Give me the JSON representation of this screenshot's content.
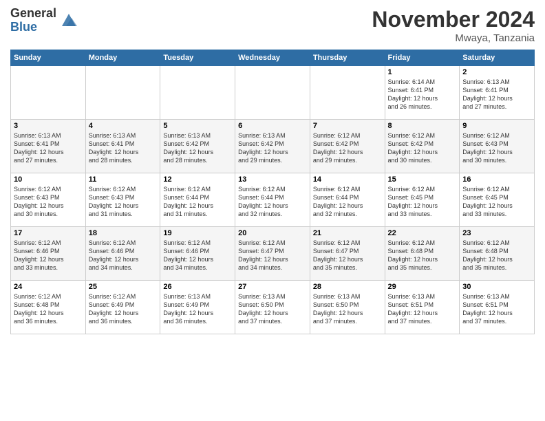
{
  "logo": {
    "general": "General",
    "blue": "Blue"
  },
  "header": {
    "month": "November 2024",
    "location": "Mwaya, Tanzania"
  },
  "weekdays": [
    "Sunday",
    "Monday",
    "Tuesday",
    "Wednesday",
    "Thursday",
    "Friday",
    "Saturday"
  ],
  "weeks": [
    [
      {
        "day": "",
        "info": ""
      },
      {
        "day": "",
        "info": ""
      },
      {
        "day": "",
        "info": ""
      },
      {
        "day": "",
        "info": ""
      },
      {
        "day": "",
        "info": ""
      },
      {
        "day": "1",
        "info": "Sunrise: 6:14 AM\nSunset: 6:41 PM\nDaylight: 12 hours\nand 26 minutes."
      },
      {
        "day": "2",
        "info": "Sunrise: 6:13 AM\nSunset: 6:41 PM\nDaylight: 12 hours\nand 27 minutes."
      }
    ],
    [
      {
        "day": "3",
        "info": "Sunrise: 6:13 AM\nSunset: 6:41 PM\nDaylight: 12 hours\nand 27 minutes."
      },
      {
        "day": "4",
        "info": "Sunrise: 6:13 AM\nSunset: 6:41 PM\nDaylight: 12 hours\nand 28 minutes."
      },
      {
        "day": "5",
        "info": "Sunrise: 6:13 AM\nSunset: 6:42 PM\nDaylight: 12 hours\nand 28 minutes."
      },
      {
        "day": "6",
        "info": "Sunrise: 6:13 AM\nSunset: 6:42 PM\nDaylight: 12 hours\nand 29 minutes."
      },
      {
        "day": "7",
        "info": "Sunrise: 6:12 AM\nSunset: 6:42 PM\nDaylight: 12 hours\nand 29 minutes."
      },
      {
        "day": "8",
        "info": "Sunrise: 6:12 AM\nSunset: 6:42 PM\nDaylight: 12 hours\nand 30 minutes."
      },
      {
        "day": "9",
        "info": "Sunrise: 6:12 AM\nSunset: 6:43 PM\nDaylight: 12 hours\nand 30 minutes."
      }
    ],
    [
      {
        "day": "10",
        "info": "Sunrise: 6:12 AM\nSunset: 6:43 PM\nDaylight: 12 hours\nand 30 minutes."
      },
      {
        "day": "11",
        "info": "Sunrise: 6:12 AM\nSunset: 6:43 PM\nDaylight: 12 hours\nand 31 minutes."
      },
      {
        "day": "12",
        "info": "Sunrise: 6:12 AM\nSunset: 6:44 PM\nDaylight: 12 hours\nand 31 minutes."
      },
      {
        "day": "13",
        "info": "Sunrise: 6:12 AM\nSunset: 6:44 PM\nDaylight: 12 hours\nand 32 minutes."
      },
      {
        "day": "14",
        "info": "Sunrise: 6:12 AM\nSunset: 6:44 PM\nDaylight: 12 hours\nand 32 minutes."
      },
      {
        "day": "15",
        "info": "Sunrise: 6:12 AM\nSunset: 6:45 PM\nDaylight: 12 hours\nand 33 minutes."
      },
      {
        "day": "16",
        "info": "Sunrise: 6:12 AM\nSunset: 6:45 PM\nDaylight: 12 hours\nand 33 minutes."
      }
    ],
    [
      {
        "day": "17",
        "info": "Sunrise: 6:12 AM\nSunset: 6:46 PM\nDaylight: 12 hours\nand 33 minutes."
      },
      {
        "day": "18",
        "info": "Sunrise: 6:12 AM\nSunset: 6:46 PM\nDaylight: 12 hours\nand 34 minutes."
      },
      {
        "day": "19",
        "info": "Sunrise: 6:12 AM\nSunset: 6:46 PM\nDaylight: 12 hours\nand 34 minutes."
      },
      {
        "day": "20",
        "info": "Sunrise: 6:12 AM\nSunset: 6:47 PM\nDaylight: 12 hours\nand 34 minutes."
      },
      {
        "day": "21",
        "info": "Sunrise: 6:12 AM\nSunset: 6:47 PM\nDaylight: 12 hours\nand 35 minutes."
      },
      {
        "day": "22",
        "info": "Sunrise: 6:12 AM\nSunset: 6:48 PM\nDaylight: 12 hours\nand 35 minutes."
      },
      {
        "day": "23",
        "info": "Sunrise: 6:12 AM\nSunset: 6:48 PM\nDaylight: 12 hours\nand 35 minutes."
      }
    ],
    [
      {
        "day": "24",
        "info": "Sunrise: 6:12 AM\nSunset: 6:48 PM\nDaylight: 12 hours\nand 36 minutes."
      },
      {
        "day": "25",
        "info": "Sunrise: 6:12 AM\nSunset: 6:49 PM\nDaylight: 12 hours\nand 36 minutes."
      },
      {
        "day": "26",
        "info": "Sunrise: 6:13 AM\nSunset: 6:49 PM\nDaylight: 12 hours\nand 36 minutes."
      },
      {
        "day": "27",
        "info": "Sunrise: 6:13 AM\nSunset: 6:50 PM\nDaylight: 12 hours\nand 37 minutes."
      },
      {
        "day": "28",
        "info": "Sunrise: 6:13 AM\nSunset: 6:50 PM\nDaylight: 12 hours\nand 37 minutes."
      },
      {
        "day": "29",
        "info": "Sunrise: 6:13 AM\nSunset: 6:51 PM\nDaylight: 12 hours\nand 37 minutes."
      },
      {
        "day": "30",
        "info": "Sunrise: 6:13 AM\nSunset: 6:51 PM\nDaylight: 12 hours\nand 37 minutes."
      }
    ]
  ]
}
